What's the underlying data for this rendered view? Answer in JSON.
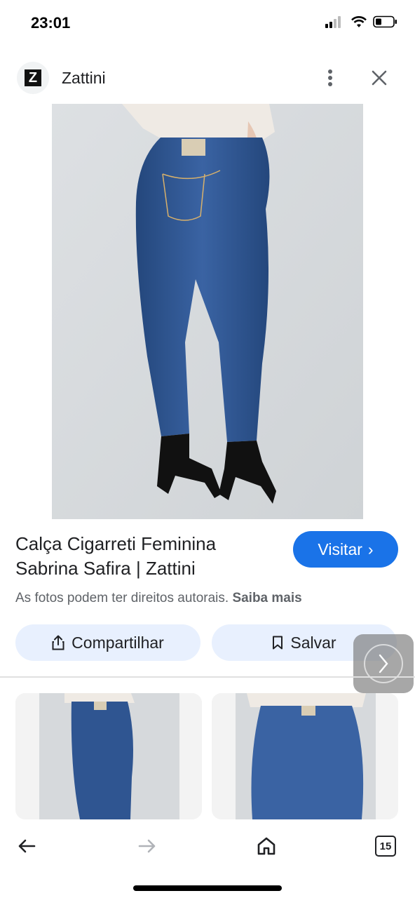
{
  "status_bar": {
    "time": "23:01"
  },
  "source": {
    "logo_letter": "Z",
    "name": "Zattini"
  },
  "product": {
    "title_line1": "Calça Cigarreti Feminina",
    "title_line2": "Sabrina Safira | Zattini"
  },
  "visit_button": {
    "label": "Visitar",
    "chevron": "›"
  },
  "notice": {
    "text": "As fotos podem ter direitos autorais.",
    "link": "Saiba mais"
  },
  "actions": {
    "share_label": "Compartilhar",
    "save_label": "Salvar"
  },
  "bottom_nav": {
    "tab_count": "15"
  },
  "colors": {
    "accent": "#1a73e8",
    "chip_bg": "#e8f0fe",
    "denim": "#2f5591",
    "backdrop": "#d9dcdf"
  },
  "icons": [
    "signal-icon",
    "wifi-icon",
    "battery-icon",
    "more-vert-icon",
    "close-icon",
    "share-icon",
    "bookmark-icon",
    "chevron-right-icon",
    "back-arrow-icon",
    "forward-arrow-icon",
    "home-icon",
    "tabs-icon"
  ]
}
